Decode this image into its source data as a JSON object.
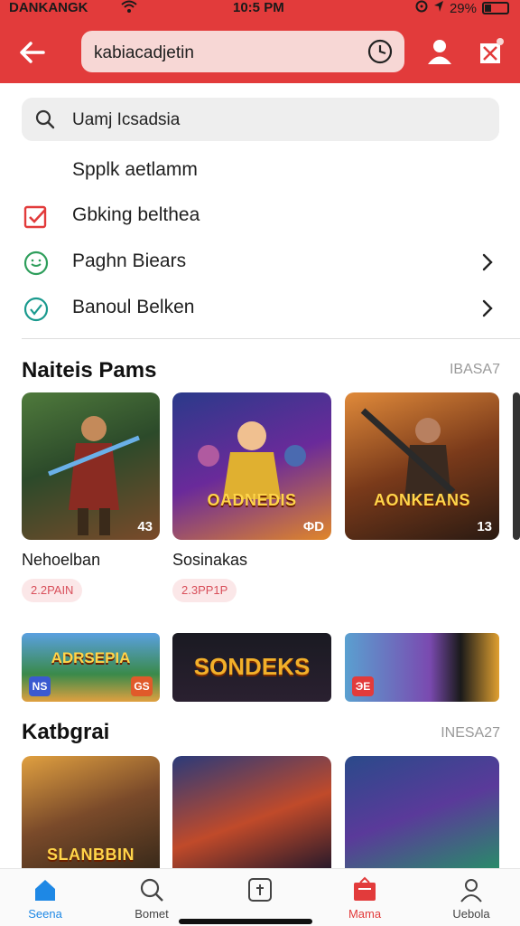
{
  "status_bar": {
    "carrier": "DANKANGK",
    "time": "10:5 PM",
    "battery": "29%",
    "battery_level": 0.29
  },
  "header": {
    "search_query": "kabiacadjetin"
  },
  "search_dropdown": {
    "query": "Uamj Icsadsia",
    "suggestions": [
      {
        "label": "Spplk aetlamm",
        "icon": "none",
        "chevron": false
      },
      {
        "label": "Gbking belthea",
        "icon": "checkbox-icon",
        "chevron": false
      },
      {
        "label": "Paghn Biears",
        "icon": "smile-circle-icon",
        "chevron": true
      },
      {
        "label": "Banoul Belken",
        "icon": "check-circle-icon",
        "chevron": true
      }
    ]
  },
  "section_1": {
    "title": "Naiteis Pams",
    "link": "IBASA7",
    "games": [
      {
        "name": "Nehoelban",
        "tag": "2.2PAIN",
        "badge": "43",
        "logo": ""
      },
      {
        "name": "Sosinakas",
        "tag": "2.3PP1P",
        "badge": "ΦD",
        "logo": "OADNEDIS"
      },
      {
        "name": "",
        "tag": "",
        "badge": "13",
        "logo": "AONKEANS"
      }
    ],
    "banners": [
      {
        "logo": "ADRSEPIA",
        "chip_left": "NS",
        "chip_right": "GS"
      },
      {
        "logo": "SONDEKS",
        "chip_left": "",
        "chip_right": ""
      },
      {
        "logo": "",
        "chip_left": "ЭE",
        "chip_right": ""
      }
    ]
  },
  "section_2": {
    "title": "Katbgrai",
    "link": "INESA27",
    "games": [
      {
        "logo": "SLANBBIN"
      },
      {
        "logo": ""
      },
      {
        "logo": ""
      }
    ]
  },
  "bottom_nav": [
    {
      "label": "Seena",
      "icon": "home-icon",
      "state": "active"
    },
    {
      "label": "Bomet",
      "icon": "search-icon",
      "state": "normal"
    },
    {
      "label": "",
      "icon": "add-box-icon",
      "state": "normal"
    },
    {
      "label": "Mama",
      "icon": "store-icon",
      "state": "hot"
    },
    {
      "label": "Uebola",
      "icon": "profile-icon",
      "state": "normal"
    }
  ],
  "colors": {
    "brand_red": "#e23b3b",
    "active_blue": "#1e88e5",
    "tag_bg": "#fbe7e8",
    "tag_text": "#d84f5a"
  }
}
